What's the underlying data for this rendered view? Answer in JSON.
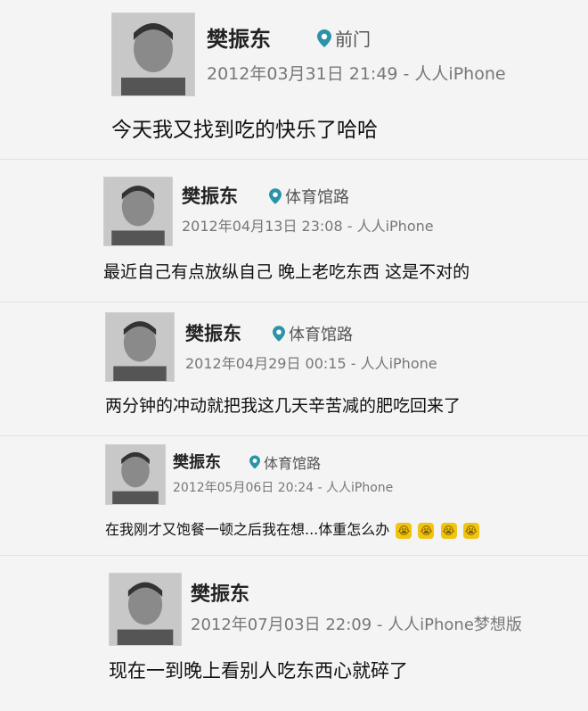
{
  "posts": [
    {
      "name": "樊振东",
      "location": "前门",
      "timestamp": "2012年03月31日 21:49 - 人人iPhone",
      "content": "今天我又找到吃的快乐了哈哈"
    },
    {
      "name": "樊振东",
      "location": "体育馆路",
      "timestamp": "2012年04月13日 23:08 - 人人iPhone",
      "content": "最近自己有点放纵自己 晚上老吃东西 这是不对的"
    },
    {
      "name": "樊振东",
      "location": "体育馆路",
      "timestamp": "2012年04月29日 00:15 - 人人iPhone",
      "content": "两分钟的冲动就把我这几天辛苦减的肥吃回来了"
    },
    {
      "name": "樊振东",
      "location": "体育馆路",
      "timestamp": "2012年05月06日 20:24 - 人人iPhone",
      "content": "在我刚才又饱餐一顿之后我在想...体重怎么办",
      "emoji_glyphs": [
        "😭",
        "😭",
        "😭",
        "😭"
      ]
    },
    {
      "name": "樊振东",
      "timestamp": "2012年07月03日 22:09 - 人人iPhone梦想版",
      "content": "现在一到晚上看别人吃东西心就碎了"
    }
  ],
  "colors": {
    "pin": "#2a93a8"
  },
  "icons": {
    "location": "location-pin-icon",
    "avatar": "avatar-photo"
  }
}
